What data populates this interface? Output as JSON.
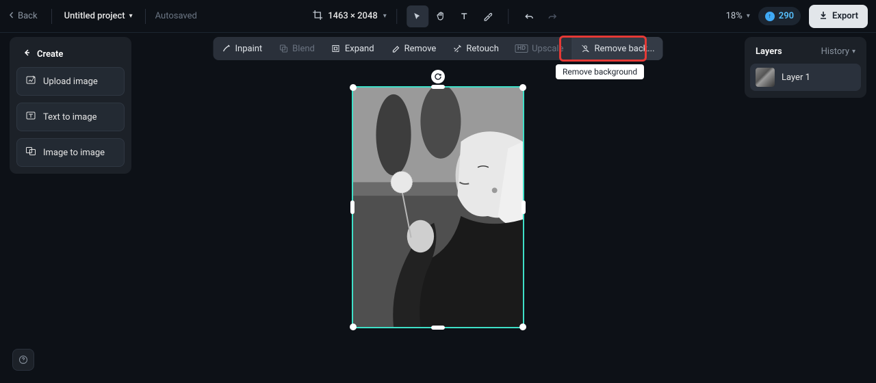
{
  "topbar": {
    "back_label": "Back",
    "project_name": "Untitled project",
    "autosaved_label": "Autosaved",
    "dimensions": "1463 × 2048",
    "zoom_label": "18%",
    "credits": "290",
    "export_label": "Export"
  },
  "action_toolbar": {
    "inpaint": "Inpaint",
    "blend": "Blend",
    "expand": "Expand",
    "remove": "Remove",
    "retouch": "Retouch",
    "upscale": "Upscale",
    "remove_bg": "Remove back..."
  },
  "tooltip": {
    "remove_bg": "Remove background"
  },
  "left_panel": {
    "create_label": "Create",
    "upload_label": "Upload image",
    "text2img_label": "Text to image",
    "img2img_label": "Image to image"
  },
  "right_panel": {
    "layers_title": "Layers",
    "history_label": "History",
    "layers": [
      {
        "name": "Layer 1"
      }
    ]
  }
}
